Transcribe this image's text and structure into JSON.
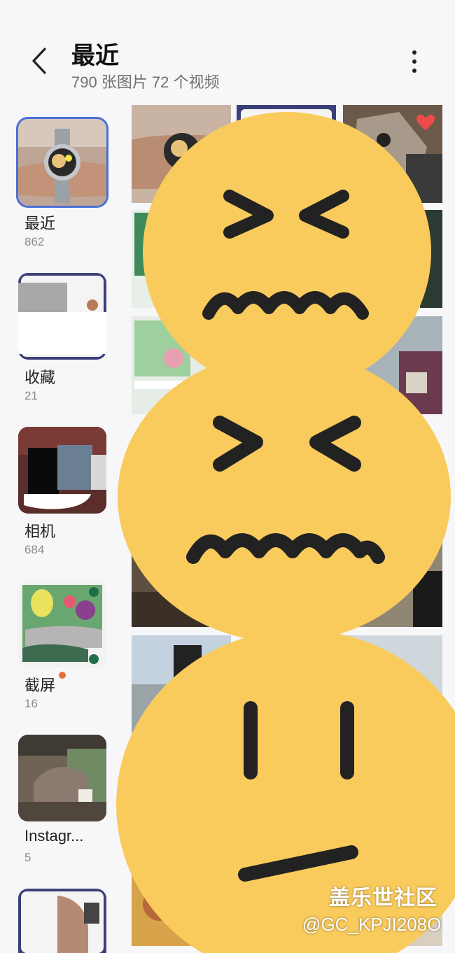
{
  "header": {
    "title": "最近",
    "subtitle": "790 张图片 72 个视频"
  },
  "albums": [
    {
      "name": "最近",
      "count": "862"
    },
    {
      "name": "收藏",
      "count": "21"
    },
    {
      "name": "相机",
      "count": "684"
    },
    {
      "name": "截屏",
      "count": "16"
    },
    {
      "name": "Instagr...",
      "count": "5"
    }
  ],
  "icons": {
    "back": "chevron-left-icon",
    "more": "more-vertical-icon",
    "favorite": "heart-icon"
  },
  "colors": {
    "accent": "#4a6fd8",
    "badge": "#e8703b",
    "emoji": "#f9cb5c",
    "heart": "#ef4b4b"
  },
  "watermark": {
    "line1": "盖乐世社区",
    "line2": "@GC_KPJI208O"
  }
}
